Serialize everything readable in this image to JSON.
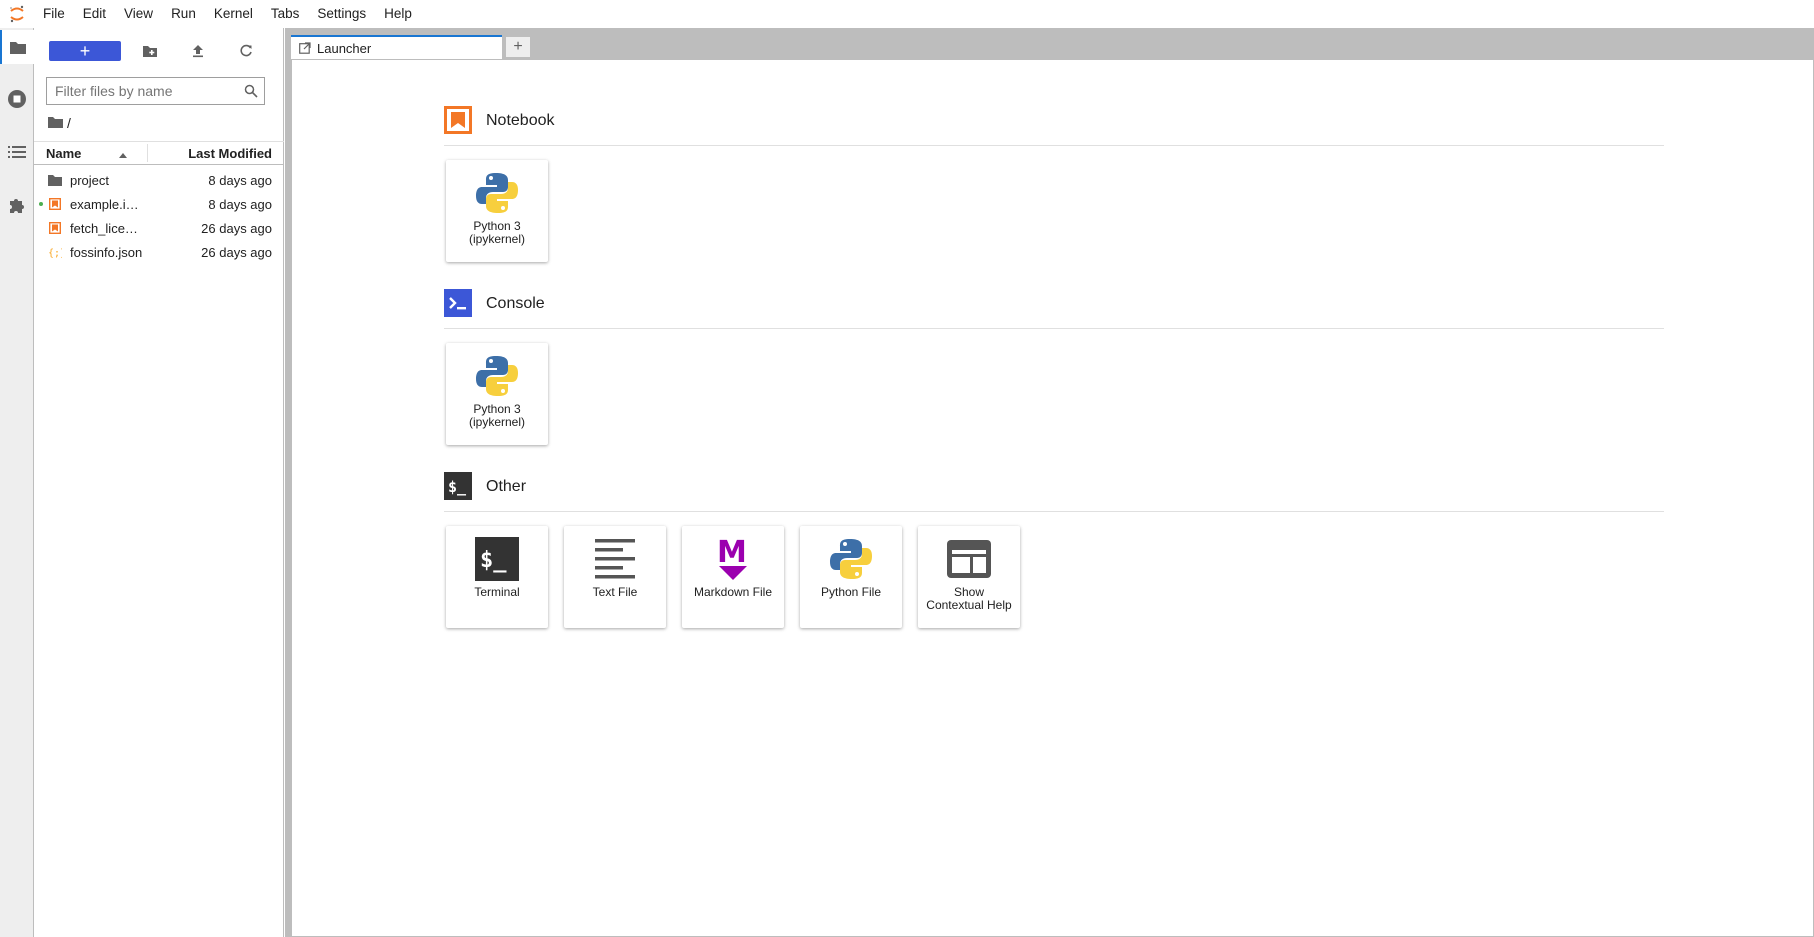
{
  "menubar": {
    "items": [
      "File",
      "Edit",
      "View",
      "Run",
      "Kernel",
      "Tabs",
      "Settings",
      "Help"
    ]
  },
  "leftbar": {
    "icons": [
      "folder-icon",
      "running-icon",
      "toc-icon",
      "extension-icon"
    ]
  },
  "filebrowser": {
    "new_launcher_label": "+",
    "filter_placeholder": "Filter files by name",
    "breadcrumb": "/",
    "columns": {
      "name": "Name",
      "modified": "Last Modified"
    },
    "files": [
      {
        "name": "project",
        "modified": "8 days ago",
        "type": "folder",
        "running": false
      },
      {
        "name": "example.i…",
        "modified": "8 days ago",
        "type": "notebook",
        "running": true
      },
      {
        "name": "fetch_lice…",
        "modified": "26 days ago",
        "type": "notebook",
        "running": false
      },
      {
        "name": "fossinfo.json",
        "modified": "26 days ago",
        "type": "json",
        "running": false
      }
    ]
  },
  "tabs": {
    "active_label": "Launcher",
    "add_label": "+"
  },
  "launcher": {
    "sections": [
      {
        "title": "Notebook",
        "cards": [
          {
            "label_line1": "Python 3",
            "label_line2": "(ipykernel)"
          }
        ]
      },
      {
        "title": "Console",
        "cards": [
          {
            "label_line1": "Python 3",
            "label_line2": "(ipykernel)"
          }
        ]
      },
      {
        "title": "Other",
        "cards": [
          {
            "label_line1": "Terminal",
            "label_line2": ""
          },
          {
            "label_line1": "Text File",
            "label_line2": ""
          },
          {
            "label_line1": "Markdown File",
            "label_line2": ""
          },
          {
            "label_line1": "Python File",
            "label_line2": ""
          },
          {
            "label_line1": "Show",
            "label_line2": "Contextual Help"
          }
        ]
      }
    ]
  },
  "colors": {
    "accent": "#3c57d7",
    "notebook_orange": "#f37726",
    "console_blue": "#3c57d7",
    "terminal_dark": "#333333",
    "markdown_purple": "#9b00af"
  }
}
